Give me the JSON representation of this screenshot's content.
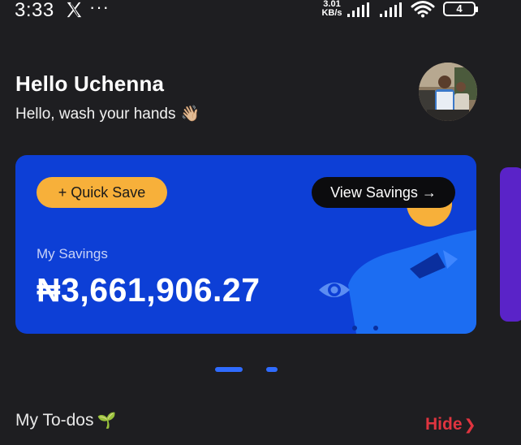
{
  "status_bar": {
    "time": "3:33",
    "x_icon": "x-logo-icon",
    "more": "···",
    "net_speed_value": "3.01",
    "net_speed_unit": "KB/s",
    "battery": "4"
  },
  "greeting": {
    "title": "Hello Uchenna",
    "subtitle": "Hello, wash your hands",
    "wave_emoji": "👋🏼"
  },
  "savings_card": {
    "quick_save_label": "+ Quick Save",
    "view_savings_label": "View Savings →",
    "label": "My Savings",
    "amount": "₦3,661,906.27",
    "card_color": "#0d3fd6",
    "accent_color": "#f7b03a"
  },
  "pager": {
    "active_index": 0,
    "count": 2
  },
  "todos": {
    "title": "My To-dos",
    "sprout_emoji": "🌱",
    "hide_label": "Hide",
    "hide_chevron": "❯",
    "hide_color": "#e0343f"
  }
}
